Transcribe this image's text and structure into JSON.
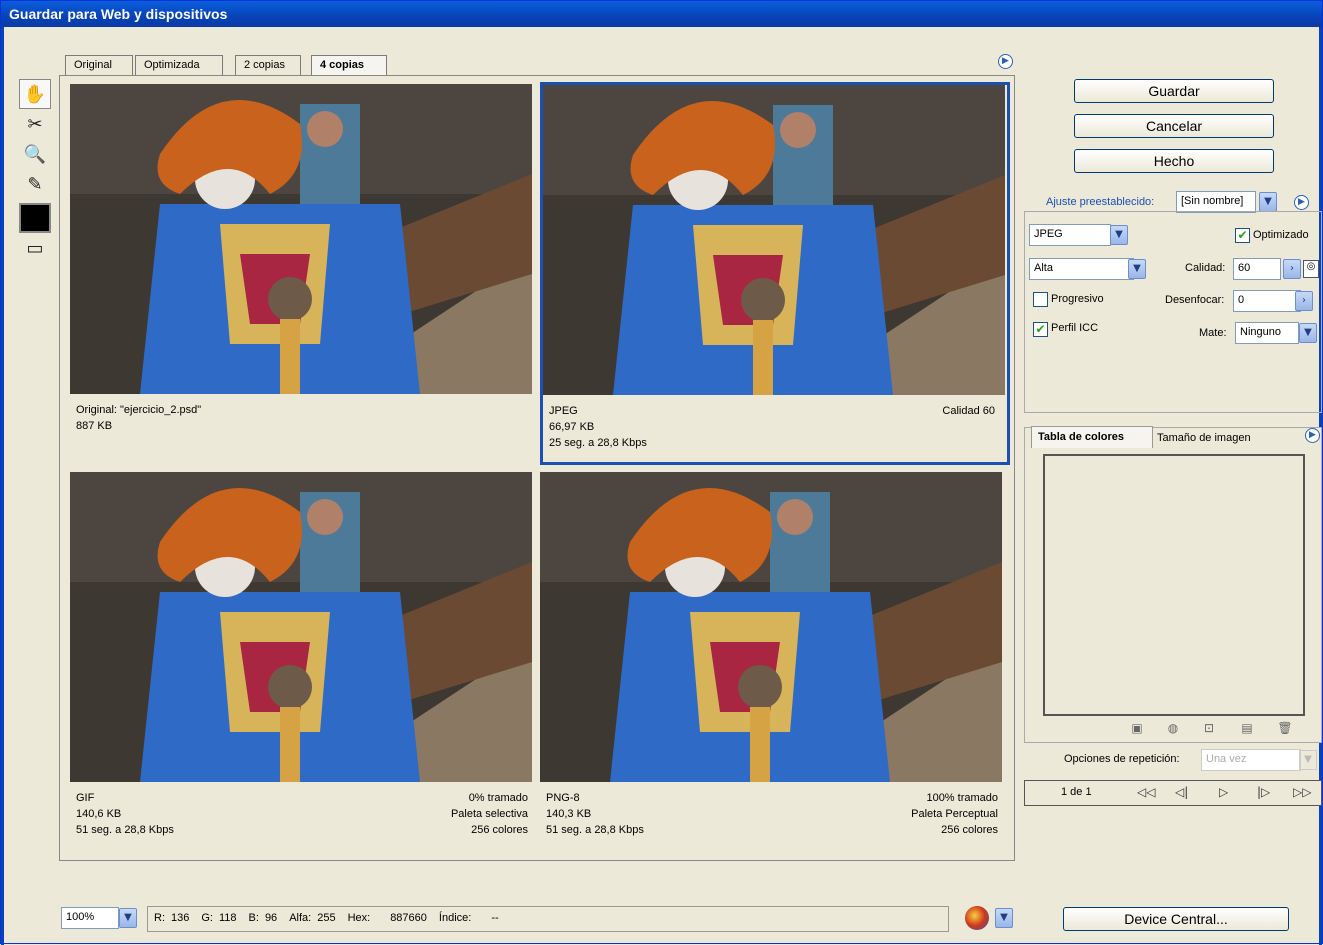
{
  "window": {
    "title": "Guardar para Web y dispositivos"
  },
  "tabs": [
    {
      "label": "Original"
    },
    {
      "label": "Optimizada"
    },
    {
      "label": "2 copias"
    },
    {
      "label": "4 copias"
    }
  ],
  "tools": [
    "hand-icon",
    "slice-select-icon",
    "zoom-icon",
    "eyedropper-icon",
    "eyedropper-color-swatch",
    "toggle-slices-icon"
  ],
  "panes": [
    {
      "left_lines": [
        "Original: \"ejercicio_2.psd\"",
        "887 KB"
      ],
      "right_lines": []
    },
    {
      "left_lines": [
        "JPEG",
        "66,97 KB",
        "25 seg. a 28,8 Kbps"
      ],
      "right_lines": [
        "Calidad 60"
      ]
    },
    {
      "left_lines": [
        "GIF",
        "140,6 KB",
        "51 seg. a 28,8 Kbps"
      ],
      "right_lines": [
        "0% tramado",
        "Paleta selectiva",
        "256 colores"
      ]
    },
    {
      "left_lines": [
        "PNG-8",
        "140,3 KB",
        "51 seg. a 28,8 Kbps"
      ],
      "right_lines": [
        "100% tramado",
        "Paleta Perceptual",
        "256 colores"
      ]
    }
  ],
  "buttons": {
    "save": "Guardar",
    "cancel": "Cancelar",
    "done": "Hecho",
    "device": "Device Central..."
  },
  "settings": {
    "preset_label": "Ajuste preestablecido:",
    "preset_value": "[Sin nombre]",
    "format": "JPEG",
    "quality_preset": "Alta",
    "optimized_label": "Optimizado",
    "optimized": true,
    "quality_label": "Calidad:",
    "quality_value": "60",
    "progressive_label": "Progresivo",
    "progressive": false,
    "blur_label": "Desenfocar:",
    "blur_value": "0",
    "icc_label": "Perfil ICC",
    "icc": true,
    "matte_label": "Mate:",
    "matte_value": "Ninguno"
  },
  "color_table": {
    "tab1": "Tabla de colores",
    "tab2": "Tamaño de imagen"
  },
  "repeat": {
    "label": "Opciones de repetición:",
    "value": "Una vez"
  },
  "animation": {
    "frame": "1 de 1"
  },
  "status": {
    "zoom": "100%",
    "r_label": "R:",
    "r": "136",
    "g_label": "G:",
    "g": "118",
    "b_label": "B:",
    "b": "96",
    "alpha_label": "Alfa:",
    "alpha": "255",
    "hex_label": "Hex:",
    "hex": "887660",
    "index_label": "Índice:",
    "index": "--"
  },
  "colors": {
    "selection": "#1a4fb3",
    "titlebar": "#0a5fdc"
  }
}
